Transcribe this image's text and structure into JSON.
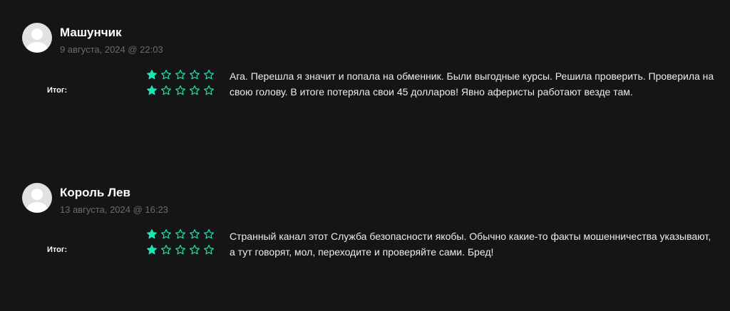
{
  "colors": {
    "accent": "#1de4b4",
    "background": "#151515",
    "date": "#6b6b6b"
  },
  "reviews": [
    {
      "author": "Машунчик",
      "date": "9 августа, 2024 @ 22:03",
      "total_label": "Итог:",
      "ratings": [
        1,
        1
      ],
      "max_rating": 5,
      "text": "Ага. Перешла я значит и попала на обменник. Были выгодные курсы. Решила проверить. Проверила на свою голову. В итоге потеряла свои 45 долларов! Явно аферисты работают везде там."
    },
    {
      "author": "Король Лев",
      "date": "13 августа, 2024 @ 16:23",
      "total_label": "Итог:",
      "ratings": [
        1,
        1
      ],
      "max_rating": 5,
      "text": "Странный канал этот Служба безопасности якобы. Обычно какие-то факты мошенничества указывают, а тут говорят, мол, переходите и проверяйте сами. Бред!"
    }
  ]
}
